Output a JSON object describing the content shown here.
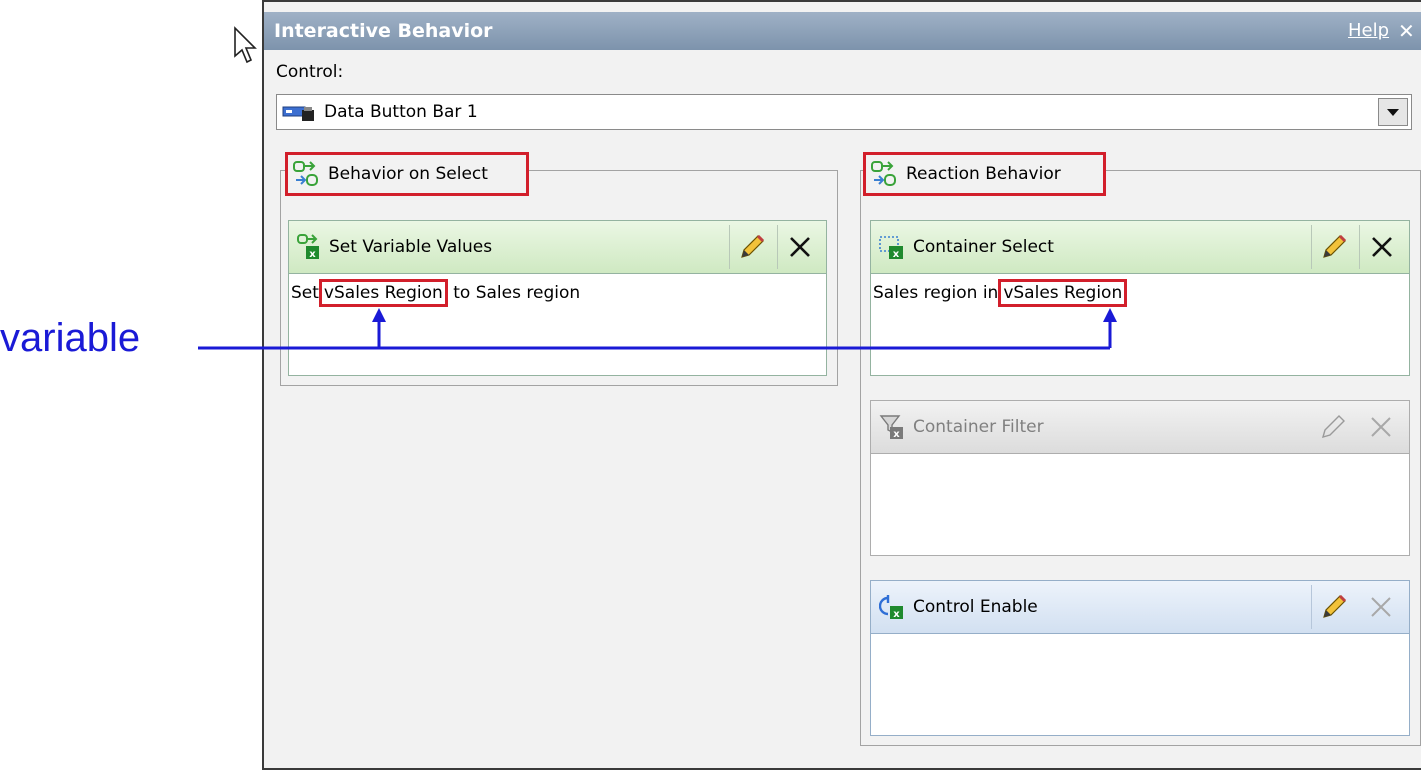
{
  "dialog": {
    "title": "Interactive Behavior",
    "help_label": "Help",
    "close_glyph": "✕"
  },
  "control": {
    "label": "Control:",
    "value": "Data Button Bar 1"
  },
  "behavior_on_select": {
    "legend": "Behavior on Select",
    "cards": [
      {
        "title": "Set Variable Values",
        "text_before": "Set",
        "variable": "vSales Region",
        "text_after": "to Sales region",
        "state": "enabled"
      }
    ]
  },
  "reaction_behavior": {
    "legend": "Reaction Behavior",
    "cards": [
      {
        "title": "Container Select",
        "text_before": "Sales region in",
        "variable": "vSales Region",
        "state": "enabled"
      },
      {
        "title": "Container Filter",
        "state": "disabled"
      },
      {
        "title": "Control Enable",
        "state": "enabled"
      }
    ]
  },
  "annotation": {
    "label": "variable",
    "color": "#1a1ad6"
  },
  "colors": {
    "highlight": "#d21f2b",
    "title_bar": "#8fa3bb"
  },
  "icons": [
    "cursor-arrow-icon",
    "data-button-bar-icon",
    "dropdown-arrow-icon",
    "behavior-icon",
    "set-variable-icon",
    "container-select-icon",
    "container-filter-icon",
    "control-enable-icon",
    "pencil-icon",
    "delete-x-icon"
  ]
}
